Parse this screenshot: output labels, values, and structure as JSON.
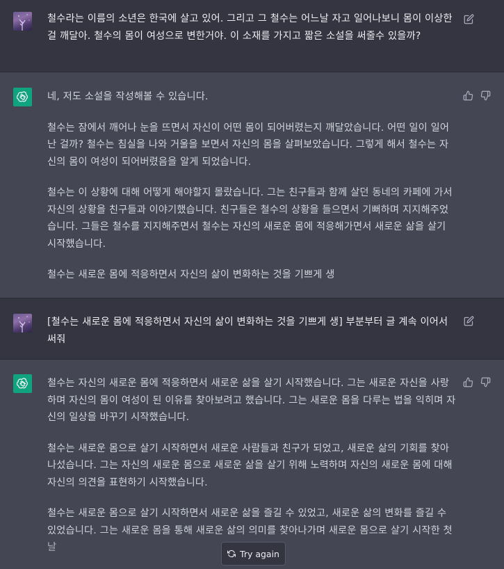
{
  "messages": [
    {
      "role": "user",
      "text": "철수라는 이름의 소년은 한국에 살고 있어. 그리고 그 철수는 어느날 자고 일어나보니 몸이 이상한걸 깨달아. 철수의 몸이 여성으로 변한거야. 이 소재를 가지고 짧은 소설을 써줄수 있을까?"
    },
    {
      "role": "assistant",
      "paragraphs": [
        "네, 저도 소설을 작성해볼 수 있습니다.",
        "철수는 잠에서 깨어나 눈을 뜨면서 자신이 어떤 몸이 되어버렸는지 깨달았습니다. 어떤 일이 일어난 걸까? 철수는 침실을 나와 거울을 보면서 자신의 몸을 살펴보았습니다. 그렇게 해서 철수는 자신의 몸이 여성이 되어버렸음을 알게 되었습니다.",
        "철수는 이 상황에 대해 어떻게 해야할지 몰랐습니다. 그는 친구들과 함께 살던 동네의 카페에 가서 자신의 상황을 친구들과 이야기했습니다. 친구들은 철수의 상황을 들으면서 기뻐하며 지지해주었습니다. 그들은 철수를 지지해주면서 철수는 자신의 새로운 몸에 적응해가면서 새로운 삶을 살기 시작했습니다.",
        "철수는 새로운 몸에 적응하면서 자신의 삶이 변화하는 것을 기쁘게 생"
      ]
    },
    {
      "role": "user",
      "text": "[철수는 새로운 몸에 적응하면서 자신의 삶이 변화하는 것을 기쁘게 생] 부분부터 글 계속 이어서 써줘"
    },
    {
      "role": "assistant",
      "paragraphs": [
        "철수는 자신의 새로운 몸에 적응하면서 새로운 삶을 살기 시작했습니다. 그는 새로운 자신을 사랑하며 자신의 몸이 여성이 된 이유를 찾아보려고 했습니다. 그는 새로운 몸을 다루는 법을 익히며 자신의 일상을 바꾸기 시작했습니다.",
        "철수는 새로운 몸으로 살기 시작하면서 새로운 사람들과 친구가 되었고, 새로운 삶의 기회를 찾아나섰습니다. 그는 자신의 새로운 몸으로 새로운 삶을 살기 위해 노력하며 자신의 새로운 몸에 대해 자신의 의견을 표현하기 시작했습니다.",
        "철수는 새로운 몸으로 살기 시작하면서 새로운 삶을 즐길 수 있었고, 새로운 삶의 변화를 즐길 수 있었습니다. 그는 새로운 몸을 통해 새로운 삶의 의미를 찾아나가며 새로운 몸으로 살기 시작한 첫 날"
      ]
    }
  ],
  "try_again_label": "Try again",
  "icons": {
    "edit": "edit-icon",
    "thumbs_up": "thumbs-up-icon",
    "thumbs_down": "thumbs-down-icon",
    "refresh": "refresh-icon",
    "bot_logo": "openai-logo-icon",
    "user_avatar": "avatar"
  },
  "colors": {
    "user_bg": "#343541",
    "assistant_bg": "#444654",
    "bot_avatar": "#10a37f",
    "text": "#d1d5db"
  }
}
